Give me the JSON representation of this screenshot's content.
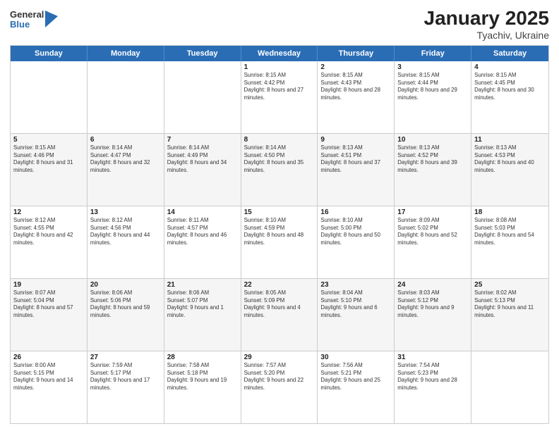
{
  "header": {
    "logo_line1": "General",
    "logo_line2": "Blue",
    "title": "January 2025",
    "subtitle": "Tyachiv, Ukraine"
  },
  "days_of_week": [
    "Sunday",
    "Monday",
    "Tuesday",
    "Wednesday",
    "Thursday",
    "Friday",
    "Saturday"
  ],
  "rows": [
    {
      "alt": false,
      "cells": [
        {
          "day": "",
          "text": ""
        },
        {
          "day": "",
          "text": ""
        },
        {
          "day": "",
          "text": ""
        },
        {
          "day": "1",
          "text": "Sunrise: 8:15 AM\nSunset: 4:42 PM\nDaylight: 8 hours and 27 minutes."
        },
        {
          "day": "2",
          "text": "Sunrise: 8:15 AM\nSunset: 4:43 PM\nDaylight: 8 hours and 28 minutes."
        },
        {
          "day": "3",
          "text": "Sunrise: 8:15 AM\nSunset: 4:44 PM\nDaylight: 8 hours and 29 minutes."
        },
        {
          "day": "4",
          "text": "Sunrise: 8:15 AM\nSunset: 4:45 PM\nDaylight: 8 hours and 30 minutes."
        }
      ]
    },
    {
      "alt": true,
      "cells": [
        {
          "day": "5",
          "text": "Sunrise: 8:15 AM\nSunset: 4:46 PM\nDaylight: 8 hours and 31 minutes."
        },
        {
          "day": "6",
          "text": "Sunrise: 8:14 AM\nSunset: 4:47 PM\nDaylight: 8 hours and 32 minutes."
        },
        {
          "day": "7",
          "text": "Sunrise: 8:14 AM\nSunset: 4:49 PM\nDaylight: 8 hours and 34 minutes."
        },
        {
          "day": "8",
          "text": "Sunrise: 8:14 AM\nSunset: 4:50 PM\nDaylight: 8 hours and 35 minutes."
        },
        {
          "day": "9",
          "text": "Sunrise: 8:13 AM\nSunset: 4:51 PM\nDaylight: 8 hours and 37 minutes."
        },
        {
          "day": "10",
          "text": "Sunrise: 8:13 AM\nSunset: 4:52 PM\nDaylight: 8 hours and 39 minutes."
        },
        {
          "day": "11",
          "text": "Sunrise: 8:13 AM\nSunset: 4:53 PM\nDaylight: 8 hours and 40 minutes."
        }
      ]
    },
    {
      "alt": false,
      "cells": [
        {
          "day": "12",
          "text": "Sunrise: 8:12 AM\nSunset: 4:55 PM\nDaylight: 8 hours and 42 minutes."
        },
        {
          "day": "13",
          "text": "Sunrise: 8:12 AM\nSunset: 4:56 PM\nDaylight: 8 hours and 44 minutes."
        },
        {
          "day": "14",
          "text": "Sunrise: 8:11 AM\nSunset: 4:57 PM\nDaylight: 8 hours and 46 minutes."
        },
        {
          "day": "15",
          "text": "Sunrise: 8:10 AM\nSunset: 4:59 PM\nDaylight: 8 hours and 48 minutes."
        },
        {
          "day": "16",
          "text": "Sunrise: 8:10 AM\nSunset: 5:00 PM\nDaylight: 8 hours and 50 minutes."
        },
        {
          "day": "17",
          "text": "Sunrise: 8:09 AM\nSunset: 5:02 PM\nDaylight: 8 hours and 52 minutes."
        },
        {
          "day": "18",
          "text": "Sunrise: 8:08 AM\nSunset: 5:03 PM\nDaylight: 8 hours and 54 minutes."
        }
      ]
    },
    {
      "alt": true,
      "cells": [
        {
          "day": "19",
          "text": "Sunrise: 8:07 AM\nSunset: 5:04 PM\nDaylight: 8 hours and 57 minutes."
        },
        {
          "day": "20",
          "text": "Sunrise: 8:06 AM\nSunset: 5:06 PM\nDaylight: 8 hours and 59 minutes."
        },
        {
          "day": "21",
          "text": "Sunrise: 8:06 AM\nSunset: 5:07 PM\nDaylight: 9 hours and 1 minute."
        },
        {
          "day": "22",
          "text": "Sunrise: 8:05 AM\nSunset: 5:09 PM\nDaylight: 9 hours and 4 minutes."
        },
        {
          "day": "23",
          "text": "Sunrise: 8:04 AM\nSunset: 5:10 PM\nDaylight: 9 hours and 6 minutes."
        },
        {
          "day": "24",
          "text": "Sunrise: 8:03 AM\nSunset: 5:12 PM\nDaylight: 9 hours and 9 minutes."
        },
        {
          "day": "25",
          "text": "Sunrise: 8:02 AM\nSunset: 5:13 PM\nDaylight: 9 hours and 11 minutes."
        }
      ]
    },
    {
      "alt": false,
      "cells": [
        {
          "day": "26",
          "text": "Sunrise: 8:00 AM\nSunset: 5:15 PM\nDaylight: 9 hours and 14 minutes."
        },
        {
          "day": "27",
          "text": "Sunrise: 7:59 AM\nSunset: 5:17 PM\nDaylight: 9 hours and 17 minutes."
        },
        {
          "day": "28",
          "text": "Sunrise: 7:58 AM\nSunset: 5:18 PM\nDaylight: 9 hours and 19 minutes."
        },
        {
          "day": "29",
          "text": "Sunrise: 7:57 AM\nSunset: 5:20 PM\nDaylight: 9 hours and 22 minutes."
        },
        {
          "day": "30",
          "text": "Sunrise: 7:56 AM\nSunset: 5:21 PM\nDaylight: 9 hours and 25 minutes."
        },
        {
          "day": "31",
          "text": "Sunrise: 7:54 AM\nSunset: 5:23 PM\nDaylight: 9 hours and 28 minutes."
        },
        {
          "day": "",
          "text": ""
        }
      ]
    }
  ]
}
